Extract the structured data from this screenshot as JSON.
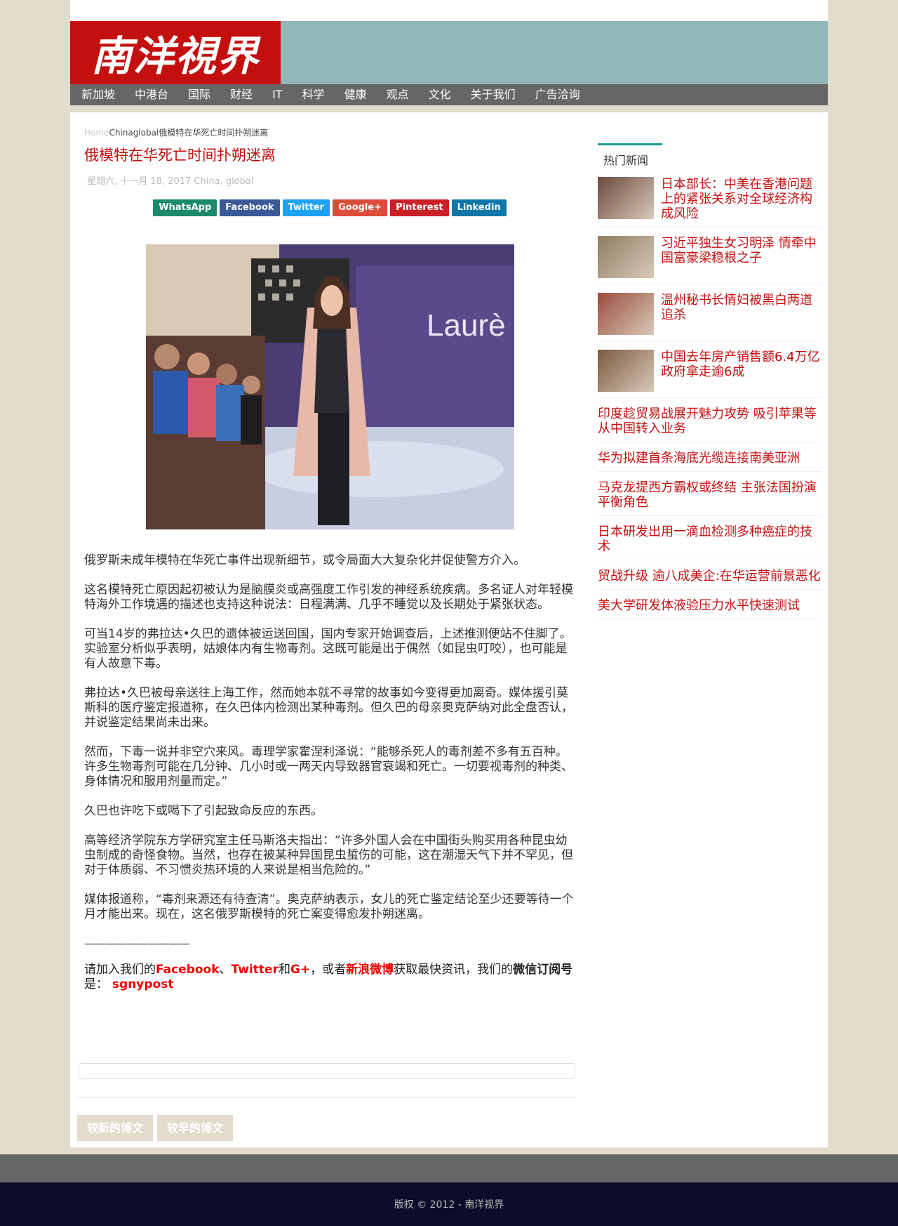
{
  "logo": {
    "text": "南洋視界"
  },
  "nav": [
    "新加坡",
    "中港台",
    "国际",
    "财经",
    "IT",
    "科学",
    "健康",
    "观点",
    "文化",
    "关于我们",
    "广告洽询"
  ],
  "breadcrumb": {
    "home": "Home",
    "rest": "Chinaglobal俄模特在华死亡时间扑朔迷离"
  },
  "article": {
    "title": "俄模特在华死亡时间扑朔迷离",
    "meta": "星期六, 十一月 18, 2017  China,  global",
    "paragraphs": [
      "俄罗斯未成年模特在华死亡事件出现新细节，或令局面大大复杂化并促使警方介入。",
      "这名模特死亡原因起初被认为是脑膜炎或高强度工作引发的神经系统疾病。多名证人对年轻模特海外工作境遇的描述也支持这种说法：日程满满、几乎不睡觉以及长期处于紧张状态。",
      "可当14岁的弗拉达•久巴的遗体被运送回国，国内专家开始调查后，上述推测便站不住脚了。实验室分析似乎表明，姑娘体内有生物毒剂。这既可能是出于偶然（如昆虫叮咬），也可能是有人故意下毒。",
      "弗拉达•久巴被母亲送往上海工作，然而她本就不寻常的故事如今变得更加离奇。媒体援引莫斯科的医疗鉴定报道称，在久巴体内检测出某种毒剂。但久巴的母亲奥克萨纳对此全盘否认，并说鉴定结果尚未出来。",
      "然而，下毒一说并非空穴来风。毒理学家霍涅利泽说：“能够杀死人的毒剂差不多有五百种。许多生物毒剂可能在几分钟、几小时或一两天内导致器官衰竭和死亡。一切要视毒剂的种类、身体情况和服用剂量而定。”",
      "久巴也许吃下或喝下了引起致命反应的东西。",
      "高等经济学院东方学研究室主任马斯洛夫指出：“许多外国人会在中国街头购买用各种昆虫幼虫制成的奇怪食物。当然，也存在被某种异国昆虫蜇伤的可能，这在潮湿天气下并不罕见，但对于体质弱、不习惯炎热环境的人来说是相当危险的。”",
      "媒体报道称，“毒剂来源还有待查清”。奥克萨纳表示，女儿的死亡鉴定结论至少还要等待一个月才能出来。现在，这名俄罗斯模特的死亡案变得愈发扑朔迷离。"
    ],
    "divider": "——————————",
    "join": {
      "prefix": "请加入我们的",
      "facebook": "Facebook",
      "sep1": "、",
      "twitter": "Twitter",
      "and": "和",
      "gplus": "G+",
      "or": "，或者",
      "weibo": "新浪微博",
      "mid": "获取最快资讯，我们的",
      "wechat": "微信订阅号",
      "is": "是：",
      "account": " sgnypost"
    },
    "photo_text": "Laurè"
  },
  "share": [
    {
      "label": "WhatsApp",
      "color": "#1b8a6b"
    },
    {
      "label": "Facebook",
      "color": "#3b5998"
    },
    {
      "label": "Twitter",
      "color": "#1da1f2"
    },
    {
      "label": "Google+",
      "color": "#dd4b39"
    },
    {
      "label": "Pinterest",
      "color": "#cb2027"
    },
    {
      "label": "Linkedin",
      "color": "#0e76a8"
    }
  ],
  "pager": {
    "newer": "较新的博文",
    "older": "较早的博文"
  },
  "sidebar": {
    "heading": "热门新闻",
    "items": [
      {
        "title": "日本部长：中美在香港问题上的紧张关系对全球经济构成风险",
        "thumb": "#6a4a3e"
      },
      {
        "title": "习近平独生女习明泽 情牵中国富豪梁稳根之子",
        "thumb": "#8f7d62"
      },
      {
        "title": "温州秘书长情妇被黑白两道追杀",
        "thumb": "#9a4b3c"
      },
      {
        "title": "中国去年房产销售额6.4万亿 政府拿走逾6成",
        "thumb": "#7b5a40"
      },
      {
        "title": "印度趁贸易战展开魅力攻势 吸引苹果等从中国转入业务"
      },
      {
        "title": "华为拟建首条海底光缆连接南美亚洲"
      },
      {
        "title": "马克龙提西方霸权或终结 主张法国扮演平衡角色"
      },
      {
        "title": "日本研发出用一滴血检测多种癌症的技术"
      },
      {
        "title": "贸战升级 逾八成美企:在华运营前景恶化"
      },
      {
        "title": "美大学研发体液验压力水平快速测试"
      }
    ]
  },
  "footer": {
    "text": "版权 © 2012 - 南洋视界"
  }
}
